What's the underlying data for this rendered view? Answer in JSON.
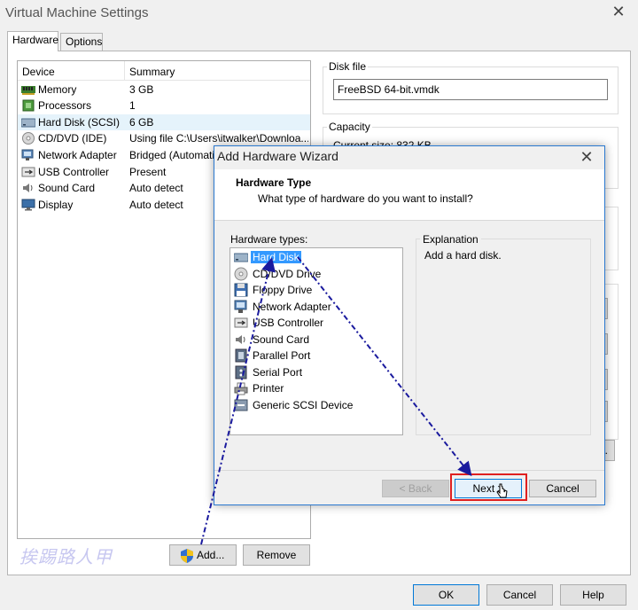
{
  "window": {
    "title": "Virtual Machine Settings"
  },
  "tabs": [
    {
      "label": "Hardware"
    },
    {
      "label": "Options"
    }
  ],
  "device_list": {
    "header": {
      "device": "Device",
      "summary": "Summary"
    },
    "rows": [
      {
        "icon": "memory-icon",
        "name": "Memory",
        "summary": "3 GB"
      },
      {
        "icon": "processor-icon",
        "name": "Processors",
        "summary": "1"
      },
      {
        "icon": "hard-disk-icon",
        "name": "Hard Disk (SCSI)",
        "summary": "6 GB"
      },
      {
        "icon": "cd-dvd-icon",
        "name": "CD/DVD (IDE)",
        "summary": "Using file C:\\Users\\itwalker\\Downloa..."
      },
      {
        "icon": "network-adapter-icon",
        "name": "Network Adapter",
        "summary": "Bridged (Automatic)"
      },
      {
        "icon": "usb-controller-icon",
        "name": "USB Controller",
        "summary": "Present"
      },
      {
        "icon": "sound-card-icon",
        "name": "Sound Card",
        "summary": "Auto detect"
      },
      {
        "icon": "display-icon",
        "name": "Display",
        "summary": "Auto detect"
      }
    ],
    "add_label": "Add...",
    "remove_label": "Remove"
  },
  "disk_file": {
    "label": "Disk file",
    "value": "FreeBSD 64-bit.vmdk"
  },
  "capacity": {
    "label": "Capacity",
    "current_size": "Current size: 832 KB"
  },
  "watermark": "挨踢路人甲",
  "footer": {
    "ok_label": "OK",
    "cancel_label": "Cancel",
    "help_label": "Help"
  },
  "wizard": {
    "title": "Add Hardware Wizard",
    "heading": "Hardware Type",
    "subheading": "What type of hardware do you want to install?",
    "hw_types_label": "Hardware types:",
    "hw_types": [
      {
        "icon": "hard-disk-icon",
        "label": "Hard Disk"
      },
      {
        "icon": "cd-dvd-icon",
        "label": "CD/DVD Drive"
      },
      {
        "icon": "floppy-icon",
        "label": "Floppy Drive"
      },
      {
        "icon": "network-adapter-icon",
        "label": "Network Adapter"
      },
      {
        "icon": "usb-controller-icon",
        "label": "USB Controller"
      },
      {
        "icon": "sound-card-icon",
        "label": "Sound Card"
      },
      {
        "icon": "parallel-port-icon",
        "label": "Parallel Port"
      },
      {
        "icon": "serial-port-icon",
        "label": "Serial Port"
      },
      {
        "icon": "printer-icon",
        "label": "Printer"
      },
      {
        "icon": "scsi-device-icon",
        "label": "Generic SCSI Device"
      }
    ],
    "selected_index": 0,
    "explanation_label": "Explanation",
    "explanation_text": "Add a hard disk.",
    "back_label": "< Back",
    "next_label": "Next >",
    "cancel_label": "Cancel"
  },
  "colors": {
    "accent": "#0078d7",
    "selection": "#3399ff",
    "annotation_arrow": "#1a1a9e",
    "highlight_box": "#e02020"
  }
}
